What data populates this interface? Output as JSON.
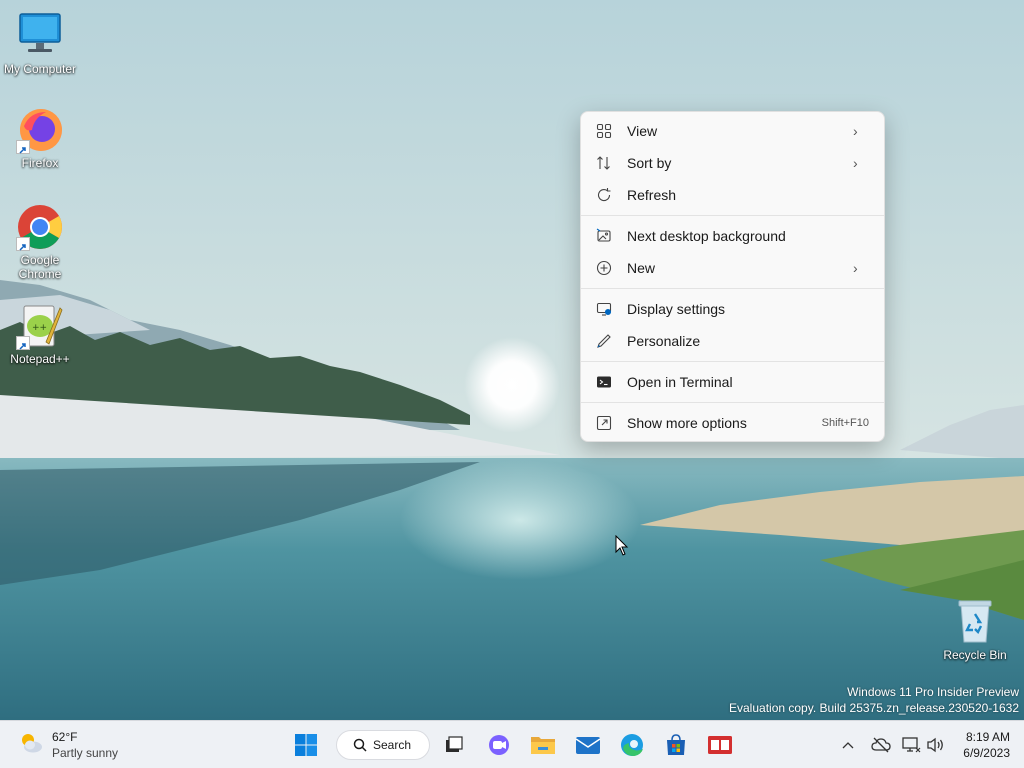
{
  "desktop": {
    "icons": [
      {
        "label": "My Computer",
        "icon": "monitor-icon"
      },
      {
        "label": "Firefox",
        "icon": "firefox-icon"
      },
      {
        "label": "Google Chrome",
        "icon": "chrome-icon"
      },
      {
        "label": "Notepad++",
        "icon": "notepadpp-icon"
      },
      {
        "label": "Recycle Bin",
        "icon": "recycle-bin-icon"
      }
    ],
    "watermark": {
      "line1": "Windows 11 Pro Insider Preview",
      "line2": "Evaluation copy. Build 25375.zn_release.230520-1632"
    }
  },
  "context_menu": {
    "items": [
      {
        "label": "View",
        "icon": "grid-icon",
        "submenu": true
      },
      {
        "label": "Sort by",
        "icon": "sort-icon",
        "submenu": true
      },
      {
        "label": "Refresh",
        "icon": "refresh-icon"
      },
      {
        "label": "Next desktop background",
        "icon": "image-next-icon"
      },
      {
        "label": "New",
        "icon": "plus-circle-icon",
        "submenu": true
      },
      {
        "label": "Display settings",
        "icon": "display-settings-icon"
      },
      {
        "label": "Personalize",
        "icon": "pen-icon"
      },
      {
        "label": "Open in Terminal",
        "icon": "terminal-icon"
      },
      {
        "label": "Show more options",
        "icon": "share-icon",
        "shortcut": "Shift+F10"
      }
    ],
    "chevron": "›"
  },
  "taskbar": {
    "weather": {
      "temp": "62°F",
      "condition": "Partly sunny",
      "icon": "partly-sunny-icon"
    },
    "search_label": "Search",
    "apps": [
      "start-icon",
      "task-view-icon",
      "chat-icon",
      "file-explorer-icon",
      "mail-icon",
      "edge-icon",
      "store-icon",
      "app-icon"
    ],
    "tray_chevron": "^",
    "clock": {
      "time": "8:19 AM",
      "date": "6/9/2023"
    }
  },
  "colors": {
    "accent": "#0067c0",
    "menu_bg": "#f9f9f9",
    "taskbar_bg": "#eef1f5"
  }
}
